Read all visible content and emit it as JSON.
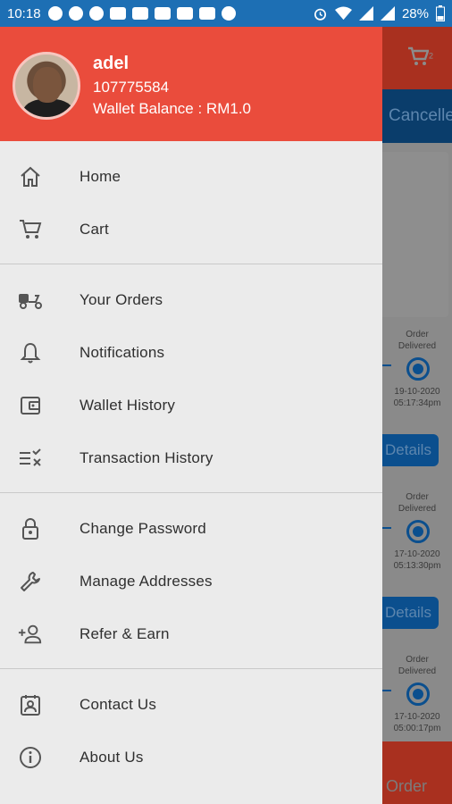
{
  "status_bar": {
    "time": "10:18",
    "battery": "28%",
    "notification_icons": [
      "location-pin-icon",
      "telegram-icon",
      "facebook-icon",
      "youtube-icon",
      "youtube-icon",
      "youtube-icon",
      "youtube-icon",
      "youtube-icon",
      "facebook-icon"
    ],
    "right_icons": [
      "alarm-icon",
      "wifi-icon",
      "signal-icon",
      "signal-icon",
      "battery-icon"
    ]
  },
  "drawer": {
    "user": {
      "name": "adel",
      "id": "107775584",
      "wallet_balance": "Wallet Balance : RM1.0"
    },
    "groups": [
      {
        "items": [
          {
            "label": "Home",
            "icon": "home-icon"
          },
          {
            "label": "Cart",
            "icon": "cart-icon"
          }
        ]
      },
      {
        "items": [
          {
            "label": "Your Orders",
            "icon": "scooter-icon"
          },
          {
            "label": "Notifications",
            "icon": "bell-icon"
          },
          {
            "label": "Wallet History",
            "icon": "wallet-icon"
          },
          {
            "label": "Transaction History",
            "icon": "list-check-icon"
          }
        ]
      },
      {
        "items": [
          {
            "label": "Change Password",
            "icon": "lock-icon"
          },
          {
            "label": "Manage Addresses",
            "icon": "wrench-icon"
          },
          {
            "label": "Refer & Earn",
            "icon": "add-person-icon"
          }
        ]
      },
      {
        "items": [
          {
            "label": "Contact Us",
            "icon": "contact-card-icon"
          },
          {
            "label": "About Us",
            "icon": "info-icon"
          }
        ]
      }
    ]
  },
  "background_app": {
    "cart_badge": "2",
    "tab_label": "Cancelle",
    "orders": [
      {
        "status_line1": "Order",
        "status_line2": "Delivered",
        "date": "19-10-2020",
        "time": "05:17:34pm",
        "details_label": "Details"
      },
      {
        "status_line1": "Order",
        "status_line2": "Delivered",
        "date": "17-10-2020",
        "time": "05:13:30pm",
        "details_label": "Details"
      },
      {
        "status_line1": "Order",
        "status_line2": "Delivered",
        "date": "17-10-2020",
        "time": "05:00:17pm"
      }
    ],
    "bottom_label": "Order"
  },
  "colors": {
    "status_bar": "#1d6fb4",
    "drawer_header": "#ea4c3c",
    "drawer_bg": "#ebebeb",
    "text": "#2f2f2f",
    "icon": "#555555"
  }
}
